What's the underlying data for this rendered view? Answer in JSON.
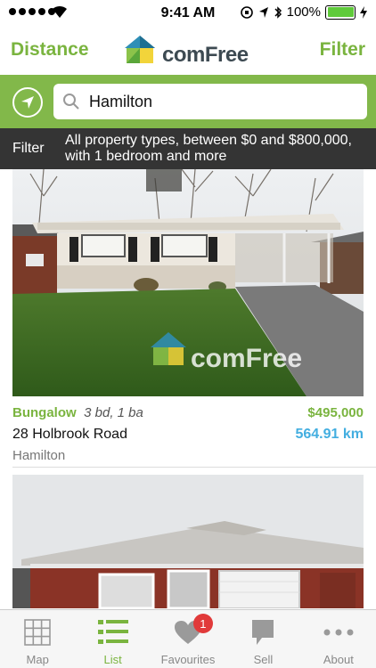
{
  "status_bar": {
    "time": "9:41 AM",
    "battery_percent": "100%"
  },
  "nav": {
    "left_label": "Distance",
    "right_label": "Filter",
    "logo_text": "comFree"
  },
  "search": {
    "value": "Hamilton",
    "icon": "search-icon"
  },
  "filter_banner": {
    "label": "Filter",
    "description": "All property types, between $0 and $800,000, with 1 bedroom and more"
  },
  "listings": [
    {
      "type": "Bungalow",
      "beds_baths": "3 bd, 1 ba",
      "price": "$495,000",
      "address": "28 Holbrook Road",
      "distance": "564.91 km",
      "city": "Hamilton",
      "watermark": "comFree"
    }
  ],
  "tabs": [
    {
      "label": "Map",
      "icon": "map-grid-icon"
    },
    {
      "label": "List",
      "icon": "list-icon",
      "active": true
    },
    {
      "label": "Favourites",
      "icon": "heart-icon",
      "badge": "1"
    },
    {
      "label": "Sell",
      "icon": "sign-icon"
    },
    {
      "label": "About",
      "icon": "more-dots-icon"
    }
  ],
  "colors": {
    "brand_green": "#7ab43f",
    "search_bar_bg": "#82b84a",
    "distance_blue": "#43aee0",
    "badge_red": "#e13a3a"
  }
}
